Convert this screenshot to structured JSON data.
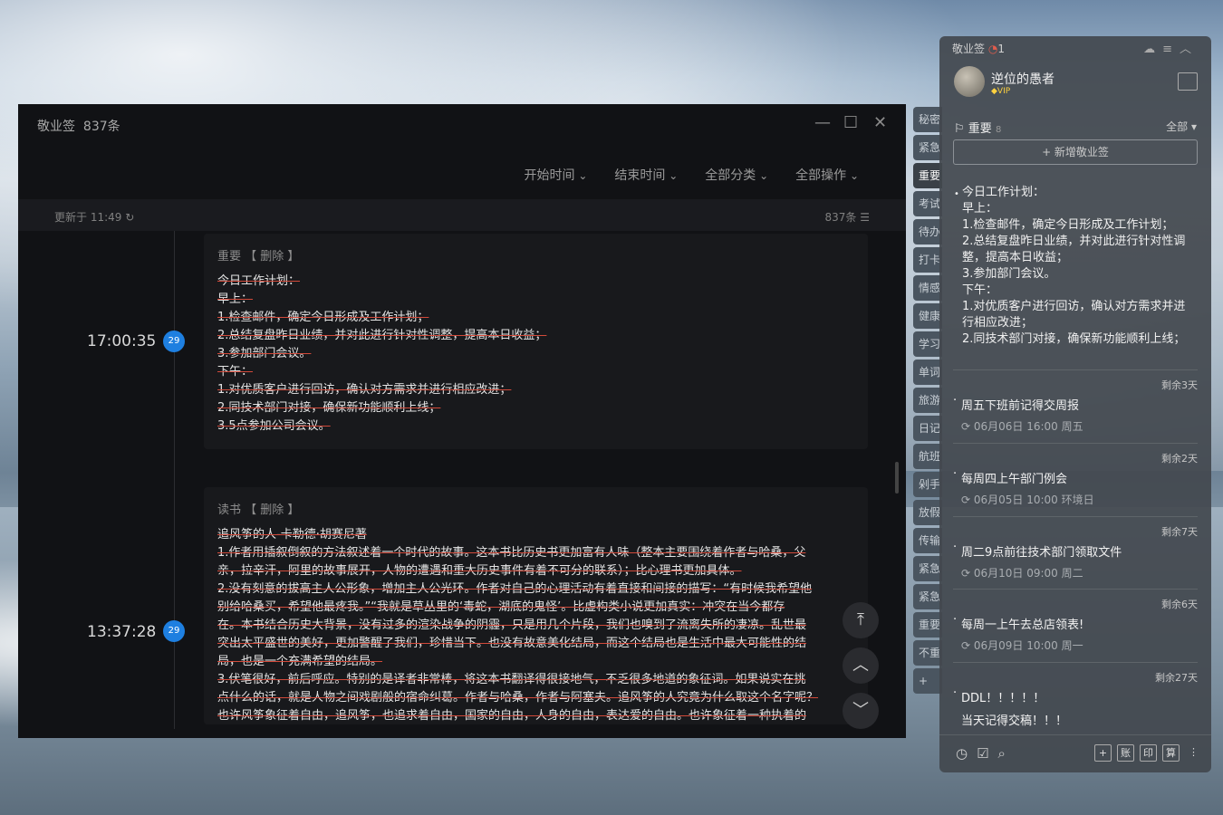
{
  "window": {
    "title": "敬业签",
    "count": "837条",
    "filters": [
      "开始时间",
      "结束时间",
      "全部分类",
      "全部操作"
    ],
    "updated": "更新于 11:49",
    "total": "837条",
    "controls": {
      "min": "—",
      "max": "☐",
      "close": "✕"
    }
  },
  "entries": [
    {
      "time": "17:00:35",
      "day": "29",
      "category": "重要",
      "action": "【 删除 】",
      "lines": [
        "今日工作计划：",
        "早上：",
        "1.检查邮件，确定今日形成及工作计划；",
        "2.总结复盘昨日业绩，并对此进行针对性调整，提高本日收益；",
        "3.参加部门会议。",
        "下午：",
        "1.对优质客户进行回访，确认对方需求并进行相应改进；",
        "2.同技术部门对接，确保新功能顺利上线；",
        "3.5点参加公司会议。"
      ]
    },
    {
      "time": "13:37:28",
      "day": "29",
      "category": "读书",
      "action": "【 删除 】",
      "lines": [
        "追风筝的人-卡勒德·胡赛尼著",
        "1.作者用插叙倒叙的方法叙述着一个时代的故事。这本书比历史书更加富有人味（整本主要围绕着作者与哈桑，父",
        "亲，拉辛汗，阿里的故事展开，人物的遭遇和重大历史事件有着不可分的联系）；比心理书更加具体。",
        "2.没有刻意的拔高主人公形象，增加主人公光环。作者对自己的心理活动有着直接和间接的描写：“有时候我希望他",
        "别给哈桑买，希望他最疼我。”“我就是草丛里的‘毒蛇，湖底的鬼怪’。比虚构类小说更加真实：冲突在当今都存",
        "在。本书结合历史大背景，没有过多的渲染战争的阴霾，只是用几个片段，我们也嗅到了流离失所的凄凉。乱世最",
        "突出太平盛世的美好，更加警醒了我们，珍惜当下。也没有故意美化结局，而这个结局也是生活中最大可能性的结",
        "局，也是一个充满希望的结局。",
        "3.伏笔很好，前后呼应。特别的是译者非常棒，将这本书翻译得很接地气，不乏很多地道的象征词。如果说实在挑",
        "点什么的话，就是人物之间戏剧般的宿命纠葛。作者与哈桑，作者与阿塞夫。追风筝的人究竟为什么取这个名字呢？",
        "也许风筝象征着自由，追风筝，也追求着自由，国家的自由，人身的自由，表达爱的自由。也许象征着一种执着的"
      ]
    }
  ],
  "fabs": {
    "top": "⤒",
    "up": "︿",
    "down": "﹀"
  },
  "tabs": [
    "秘密",
    "紧急",
    "重要",
    "考试",
    "待办",
    "打卡",
    "情感",
    "健康",
    "学习",
    "单词",
    "旅游",
    "日记",
    "航班",
    "剁手",
    "放假",
    "传输",
    "紧急",
    "紧急",
    "重要",
    "不重"
  ],
  "tab_add": "+",
  "side": {
    "app": "敬业签",
    "msg_count": "1",
    "user": "逆位的愚者",
    "vip": "VIP",
    "section": "重要",
    "section_count": "8",
    "filter": "全部",
    "add_label": "+ 新增敬业签",
    "note_lines": [
      "今日工作计划：",
      "早上：",
      "1.检查邮件，确定今日形成及工作计划；",
      "2.总结复盘昨日业绩，并对此进行针对性调整，提高本日收益；",
      "3.参加部门会议。",
      "下午：",
      "1.对优质客户进行回访，确认对方需求并进行相应改进；",
      "2.同技术部门对接，确保新功能顺利上线；"
    ],
    "items": [
      {
        "remain": "剩余3天",
        "title": "周五下班前记得交周报",
        "sub": "06月06日 16:00 周五"
      },
      {
        "remain": "剩余2天",
        "title": "每周四上午部门例会",
        "sub": "06月05日 10:00 环境日"
      },
      {
        "remain": "剩余7天",
        "title": "周二9点前往技术部门领取文件",
        "sub": "06月10日 09:00 周二"
      },
      {
        "remain": "剩余6天",
        "title": "每周一上午去总店领表!",
        "sub": "06月09日 10:00 周一"
      },
      {
        "remain": "剩余27天",
        "title": "DDL！！！！！",
        "sub": "当天记得交稿！！！"
      }
    ],
    "foot_right": [
      "+",
      "账",
      "印",
      "算"
    ]
  },
  "colors": {
    "accent": "#1e7fe0",
    "strike": "#d24a3a"
  }
}
